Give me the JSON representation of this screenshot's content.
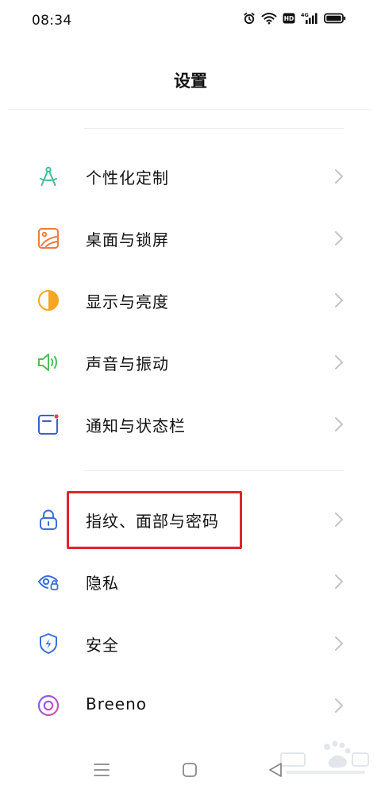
{
  "status_bar": {
    "time": "08:34",
    "icons": [
      "alarm-icon",
      "wifi-icon",
      "hd-icon",
      "signal-4g-icon",
      "battery-icon"
    ],
    "network_label": "4G",
    "hd_label": "HD"
  },
  "header": {
    "title": "设置"
  },
  "settings": {
    "items": [
      {
        "label": "个性化定制",
        "icon": "compass-icon",
        "color": "#3cbf96"
      },
      {
        "label": "桌面与锁屏",
        "icon": "wallpaper-icon",
        "color": "#f27a3d"
      },
      {
        "label": "显示与亮度",
        "icon": "brightness-icon",
        "color": "#f5a623"
      },
      {
        "label": "声音与振动",
        "icon": "speaker-icon",
        "color": "#4cbf5a"
      },
      {
        "label": "通知与状态栏",
        "icon": "notification-icon",
        "color": "#3a5fcd"
      },
      {
        "label": "指纹、面部与密码",
        "icon": "lock-icon",
        "color": "#3a6fd8"
      },
      {
        "label": "隐私",
        "icon": "privacy-eye-icon",
        "color": "#3a6fd8"
      },
      {
        "label": "安全",
        "icon": "shield-icon",
        "color": "#3a6fd8"
      },
      {
        "label": "Breeno",
        "icon": "breeno-icon",
        "color": "#b046d6"
      }
    ]
  },
  "annotation": {
    "highlight_color": "#e0242c",
    "highlighted_item": "指纹、面部与密码"
  },
  "nav_bar": {
    "buttons": [
      "menu-icon",
      "home-icon",
      "back-icon"
    ]
  }
}
